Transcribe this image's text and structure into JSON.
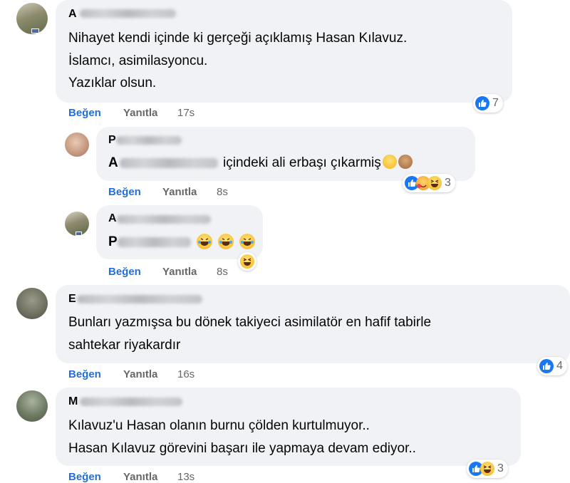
{
  "comments": [
    {
      "author_visible": "A",
      "lines": [
        "Nihayet kendi içinde ki gerçeği açıklamış Hasan Kılavuz.",
        "İslamcı, asimilasyoncu.",
        "Yazıklar olsun."
      ],
      "actions": {
        "like": "Beğen",
        "reply": "Yanıtla",
        "time": "17s"
      },
      "reactions": {
        "count": "7",
        "icons": [
          "like-icon"
        ]
      }
    },
    {
      "author_visible": "P",
      "mention_visible": "A",
      "line": "içindeki ali erbaşı çıkarmiş",
      "inline_emoji": [
        "rofl-emoji",
        "see-no-evil-monkey-emoji"
      ],
      "actions": {
        "like": "Beğen",
        "reply": "Yanıtla",
        "time": "8s"
      },
      "reactions": {
        "count": "3",
        "icons": [
          "like-icon",
          "care-icon",
          "haha-icon"
        ]
      }
    },
    {
      "author_visible": "A",
      "mention_visible": "P",
      "inline_emoji": [
        "laughing-crying-emoji",
        "laughing-crying-emoji",
        "laughing-crying-emoji"
      ],
      "actions": {
        "like": "Beğen",
        "reply": "Yanıtla",
        "time": "8s"
      },
      "reactions": {
        "icons": [
          "haha-icon"
        ]
      }
    },
    {
      "author_visible": "E",
      "lines": [
        "Bunları yazmışsa bu dönek takiyeci asimilatör en hafif tabirle",
        "sahtekar riyakardır"
      ],
      "actions": {
        "like": "Beğen",
        "reply": "Yanıtla",
        "time": "16s"
      },
      "reactions": {
        "count": "4",
        "icons": [
          "like-icon"
        ]
      }
    },
    {
      "author_visible": "M",
      "lines": [
        "Kılavuz'u Hasan olanın burnu çölden kurtulmuyor..",
        "Hasan Kılavuz görevini başarı ile yapmaya devam ediyor.."
      ],
      "actions": {
        "like": "Beğen",
        "reply": "Yanıtla",
        "time": "13s"
      },
      "reactions": {
        "count": "3",
        "icons": [
          "like-icon",
          "haha-icon"
        ]
      }
    }
  ],
  "colors": {
    "like_blue": "#216fdb",
    "bubble_bg": "#f0f2f5",
    "meta_gray": "#65676b",
    "reaction_like": "#1877f2",
    "haha_yellow": "#f7c237"
  }
}
